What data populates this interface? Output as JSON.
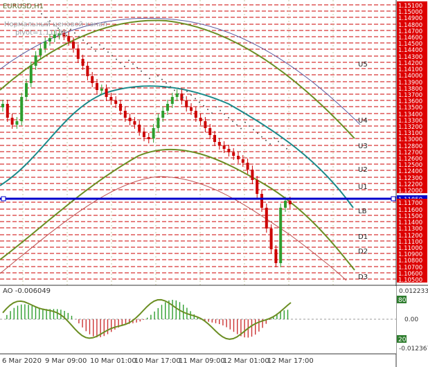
{
  "window": {
    "symbol_title": "EURUSD,H1",
    "note_line1": "Нормальный ценовой канал",
    "note_line2": "pivot=1.11185"
  },
  "price_axis": {
    "labels": [
      "1.15100",
      "1.15000",
      "1.14900",
      "1.14800",
      "1.14700",
      "1.14600",
      "1.14500",
      "1.14400",
      "1.14300",
      "1.14200",
      "1.14100",
      "1.14000",
      "1.13900",
      "1.13800",
      "1.13700",
      "1.13600",
      "1.13500",
      "1.13400",
      "1.13300",
      "1.13200",
      "1.13100",
      "1.13000",
      "1.12800",
      "1.12700",
      "1.12600",
      "1.12500",
      "1.12400",
      "1.12300",
      "1.12200",
      "1.12000",
      "1.11850",
      "1.11700",
      "1.11600",
      "1.11500",
      "1.11400",
      "1.11300",
      "1.11200",
      "1.11100",
      "1.11000",
      "1.10900",
      "1.10800",
      "1.10700",
      "1.10600",
      "1.10500"
    ],
    "highlighted": "1.11850"
  },
  "levels": {
    "labels": [
      "U5",
      "U4",
      "U3",
      "U2",
      "U1",
      "LB",
      "D1",
      "D2",
      "D3"
    ]
  },
  "oscillator": {
    "title": "AO -0.006049",
    "axis_labels": [
      "0.012233",
      "0.00",
      "-0.012367"
    ],
    "level_boxes": [
      "80",
      "20"
    ]
  },
  "time_axis": {
    "labels": [
      "6 Mar 2020",
      "9 Mar 09:00",
      "10 Mar 01:00",
      "10 Mar 17:00",
      "11 Mar 09:00",
      "12 Mar 01:00",
      "12 Mar 17:00"
    ]
  },
  "colors": {
    "red_grid": "#cc0000",
    "pivot_blue": "#0000cc",
    "teal_ma": "#1a8a8a",
    "olive_ma": "#6b8e23",
    "candle_red": "#cc0000",
    "candle_green": "#2e9e2e",
    "axis_box_red": "#dd0000"
  }
}
